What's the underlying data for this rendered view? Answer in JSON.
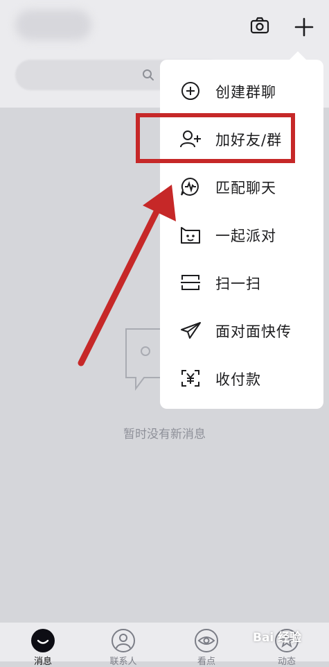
{
  "header": {
    "camera_icon": "camera-icon",
    "add_icon": "plus-icon",
    "search_icon": "search-icon"
  },
  "empty_state": {
    "text": "暂时没有新消息",
    "icon": "empty-message-icon"
  },
  "menu": {
    "items": [
      {
        "label": "创建群聊",
        "icon": "create-group-icon"
      },
      {
        "label": "加好友/群",
        "icon": "add-friend-icon"
      },
      {
        "label": "匹配聊天",
        "icon": "match-chat-icon"
      },
      {
        "label": "一起派对",
        "icon": "party-icon"
      },
      {
        "label": "扫一扫",
        "icon": "scan-icon"
      },
      {
        "label": "面对面快传",
        "icon": "face-to-face-transfer-icon"
      },
      {
        "label": "收付款",
        "icon": "payment-icon"
      }
    ]
  },
  "annotation": {
    "highlight_color": "#c62828"
  },
  "tabbar": {
    "tabs": [
      {
        "label": "消息",
        "icon": "message-tab-icon",
        "active": true
      },
      {
        "label": "联系人",
        "icon": "contacts-tab-icon",
        "active": false
      },
      {
        "label": "看点",
        "icon": "eye-tab-icon",
        "active": false
      },
      {
        "label": "动态",
        "icon": "star-tab-icon",
        "active": false
      }
    ]
  },
  "watermark": {
    "text": "Bai 经验"
  }
}
